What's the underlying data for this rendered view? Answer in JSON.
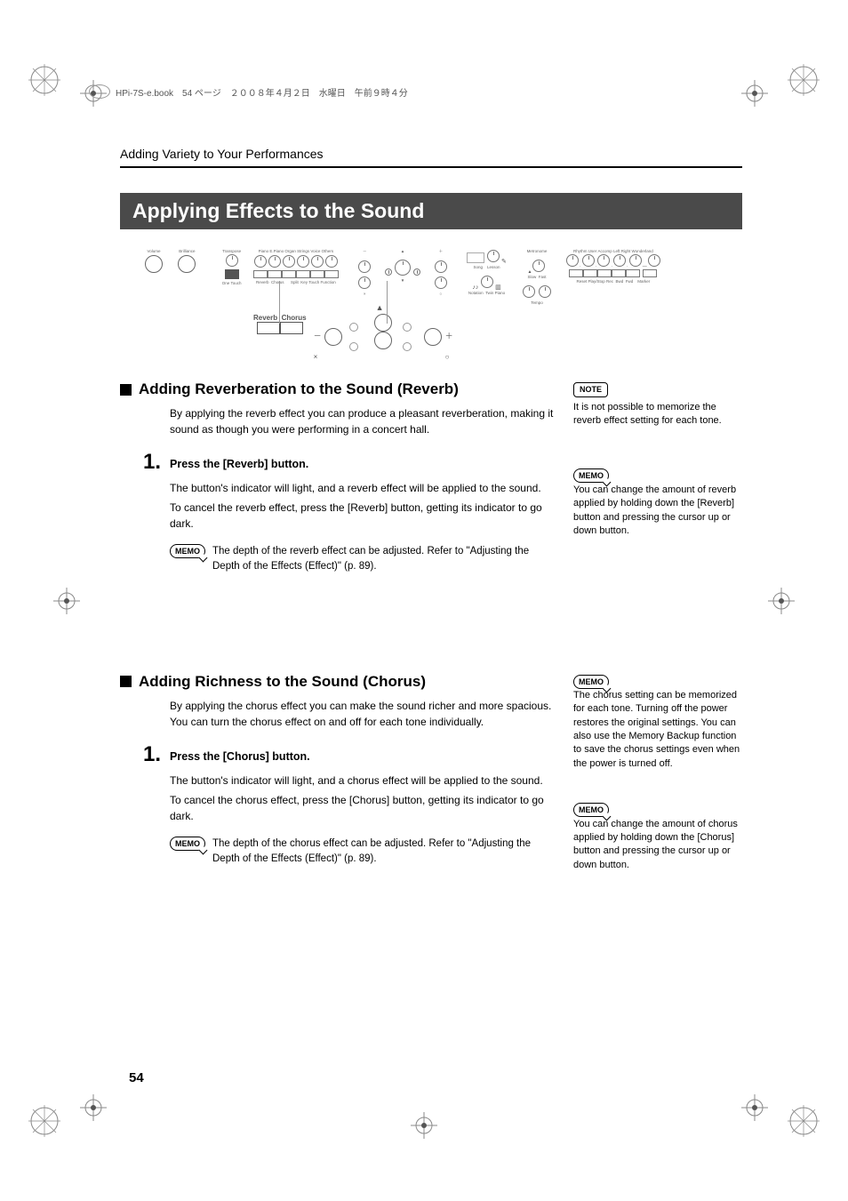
{
  "header_meta": "HPi-7S-e.book　54 ページ　２００８年４月２日　水曜日　午前９時４分",
  "breadcrumb": "Adding Variety to Your Performances",
  "section_title": "Applying Effects to the Sound",
  "reverb": {
    "heading": "Adding Reverberation to the Sound (Reverb)",
    "intro": "By applying the reverb effect you can produce a pleasant reverberation, making it sound as though you were performing in a concert hall.",
    "step_num": "1.",
    "step_title": "Press the [Reverb] button.",
    "step_body1": "The button's indicator will light, and a reverb effect will be applied to the sound.",
    "step_body2": "To cancel the reverb effect, press the [Reverb] button, getting its indicator to go dark.",
    "memo": "The depth of the reverb effect can be adjusted. Refer to \"Adjusting the Depth of the Effects (Effect)\" (p. 89).",
    "side_note": "It is not possible to memorize the reverb effect setting for each tone.",
    "side_memo": "You can change the amount of reverb applied by holding down the [Reverb] button and pressing the cursor up or down button."
  },
  "chorus": {
    "heading": "Adding Richness to the Sound (Chorus)",
    "intro": "By applying the chorus effect you can make the sound richer and more spacious. You can turn the chorus effect on and off for each tone individually.",
    "step_num": "1.",
    "step_title": "Press the [Chorus] button.",
    "step_body1": "The button's indicator will light, and a chorus effect will be applied to the sound.",
    "step_body2": "To cancel the chorus effect, press the [Chorus] button, getting its indicator to go dark.",
    "memo": "The depth of the chorus effect can be adjusted. Refer to \"Adjusting the Depth of the Effects (Effect)\" (p. 89).",
    "side_memo1": "The chorus setting can be memorized for each tone. Turning off the power restores the original settings. You can also use the Memory Backup function to save the chorus settings even when the power is turned off.",
    "side_memo2": "You can change the amount of chorus applied by holding down the [Chorus] button and pressing the cursor up or down button."
  },
  "labels": {
    "note": "NOTE",
    "memo": "MEMO",
    "reverb_btn": "Reverb",
    "chorus_btn": "Chorus"
  },
  "page_number": "54"
}
